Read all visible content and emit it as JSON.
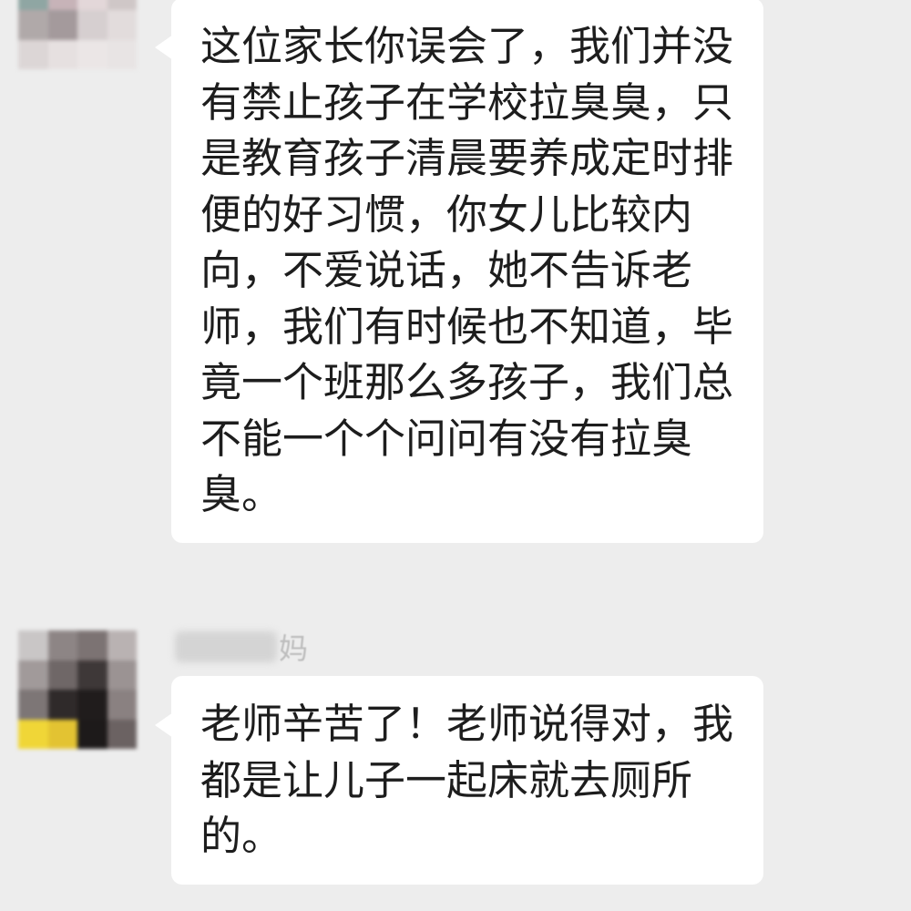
{
  "messages": [
    {
      "lines": [
        "这位家长你误会了，我们并没",
        "有禁止孩子在学校拉臭臭，只",
        "是教育孩子清晨要养成定时排",
        "便的好习惯，你女儿比较内",
        "向，不爱说话，她不告诉老",
        "师，我们有时候也不知道，毕",
        "竟一个班那么多孩子，我们总",
        "不能一个个问问有没有拉臭",
        "臭。"
      ]
    },
    {
      "sender_name_visible": "妈",
      "lines": [
        "老师辛苦了！老师说得对，我",
        "都是让儿子一起床就去厕所",
        "的。"
      ]
    }
  ],
  "avatars": {
    "teacher": [
      "#9bb0ad",
      "#5a5555",
      "#b7a4a8",
      "#d9d3d3",
      "#8fa6a3",
      "#c7b3b8",
      "#e3d7d9",
      "#cfc7c7",
      "#b0a9a9",
      "#a49a9c",
      "#d6cfd0",
      "#e2dcdc",
      "#dcd6d6",
      "#e6e0e0",
      "#ebe6e6",
      "#e8e4e4"
    ],
    "parent": [
      "#c9c6c6",
      "#8d8585",
      "#7c7373",
      "#b9b2b2",
      "#a19a9a",
      "#6f6767",
      "#3e3838",
      "#9b9393",
      "#7d7676",
      "#2f2a2a",
      "#201c1c",
      "#8a8181",
      "#f0d637",
      "#e3c332",
      "#1d1a1a",
      "#6b6262"
    ]
  }
}
